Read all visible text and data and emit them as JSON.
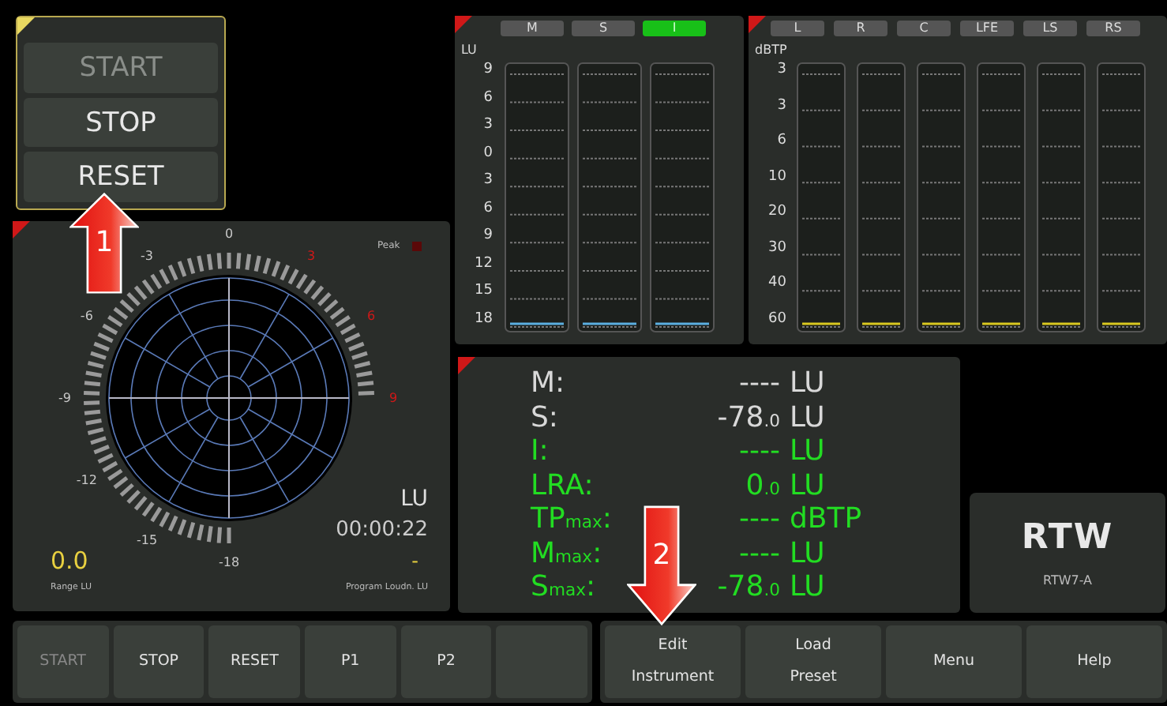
{
  "control_panel": {
    "buttons": [
      {
        "label": "START",
        "disabled": true
      },
      {
        "label": "STOP",
        "disabled": false
      },
      {
        "label": "RESET",
        "disabled": false
      }
    ]
  },
  "goniometer": {
    "peak_label": "Peak",
    "peak_on": false,
    "scale": [
      {
        "label": "0",
        "kind": "under"
      },
      {
        "label": "-3",
        "kind": "under"
      },
      {
        "label": "-6",
        "kind": "under"
      },
      {
        "label": "-9",
        "kind": "under"
      },
      {
        "label": "-12",
        "kind": "under"
      },
      {
        "label": "-15",
        "kind": "under"
      },
      {
        "label": "-18",
        "kind": "under"
      },
      {
        "label": "3",
        "kind": "over"
      },
      {
        "label": "6",
        "kind": "over"
      },
      {
        "label": "9",
        "kind": "over"
      }
    ],
    "range_value": "0.0",
    "range_label": "Range LU",
    "unit": "LU",
    "time": "00:00:22",
    "program_value": "-",
    "program_label": "Program Loudn. LU"
  },
  "loudness_meter": {
    "unit": "LU",
    "tabs": [
      {
        "label": "M",
        "selected": false
      },
      {
        "label": "S",
        "selected": false
      },
      {
        "label": "I",
        "selected": true
      }
    ],
    "scale": [
      "9",
      "6",
      "3",
      "0",
      "3",
      "6",
      "9",
      "12",
      "15",
      "18"
    ]
  },
  "peak_meter": {
    "unit": "dBTP",
    "channels": [
      {
        "label": "L"
      },
      {
        "label": "R"
      },
      {
        "label": "C"
      },
      {
        "label": "LFE"
      },
      {
        "label": "LS"
      },
      {
        "label": "RS"
      }
    ],
    "scale": [
      "3",
      "3",
      "6",
      "10",
      "20",
      "30",
      "40",
      "60"
    ]
  },
  "readings": [
    {
      "label": "M:",
      "value": "----",
      "unit": "LU",
      "color": "#d8d8d8"
    },
    {
      "label": "S:",
      "value": "-78$_{.0}$",
      "unit": "LU",
      "color": "#d8d8d8"
    },
    {
      "label": "I:",
      "value": "----",
      "unit": "LU",
      "color": "#22dd22"
    },
    {
      "label": "LRA:",
      "value": "0$_{.0}$",
      "unit": "LU",
      "color": "#22dd22"
    },
    {
      "label": "TP$_{max}$:",
      "value": "----",
      "unit": "dBTP",
      "color": "#22dd22"
    },
    {
      "label": "M$_{max}$:",
      "value": "----",
      "unit": "LU",
      "color": "#22dd22"
    },
    {
      "label": "S$_{max}$:",
      "value": "-78$_{.0}$",
      "unit": "LU",
      "color": "#22dd22"
    }
  ],
  "logo": {
    "brand": "RTW",
    "model": "RTW7-A"
  },
  "bottom_left": [
    {
      "label": "START",
      "disabled": true
    },
    {
      "label": "STOP",
      "disabled": false
    },
    {
      "label": "RESET",
      "disabled": false
    },
    {
      "label": "P1",
      "disabled": false
    },
    {
      "label": "P2",
      "disabled": false
    }
  ],
  "bottom_right": [
    {
      "lines": [
        "Edit",
        "Instrument"
      ]
    },
    {
      "lines": [
        "Load",
        "Preset"
      ]
    },
    {
      "lines": [
        "Menu"
      ]
    },
    {
      "lines": [
        "Help"
      ]
    }
  ],
  "callouts": [
    {
      "number": "1",
      "kind": "up"
    },
    {
      "number": "2",
      "kind": "down"
    }
  ]
}
